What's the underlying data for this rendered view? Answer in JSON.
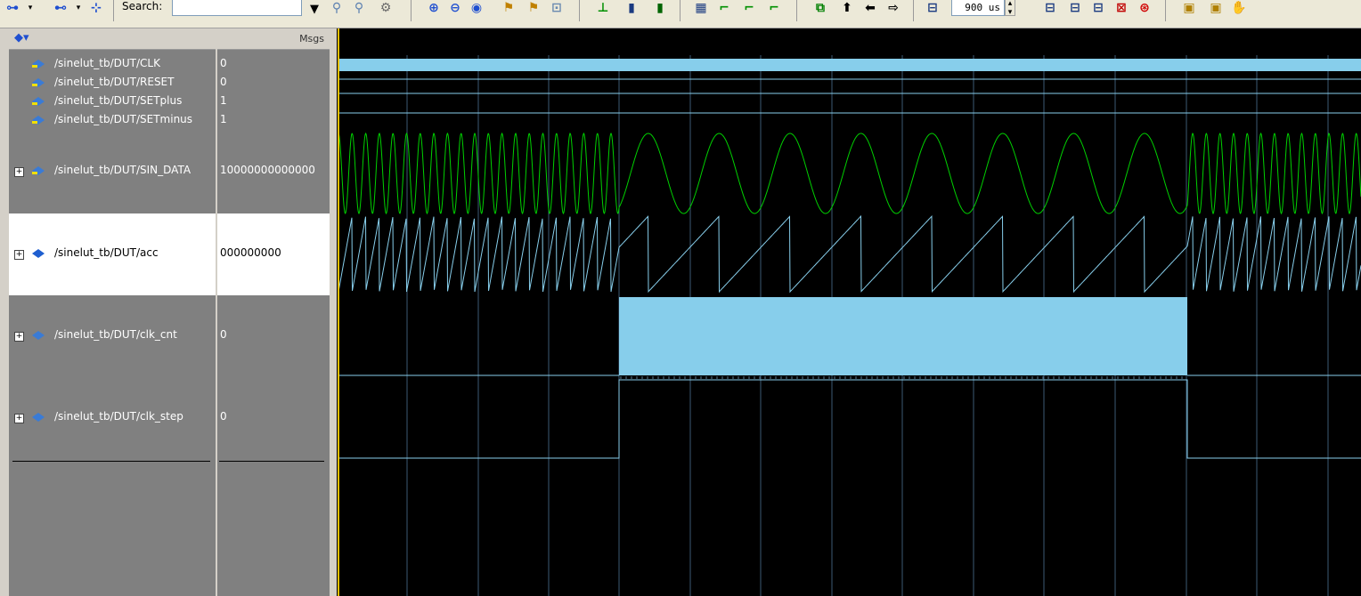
{
  "toolbar": {
    "search_label": "Search:",
    "search_value": "",
    "time_value": "900 us",
    "icons": [
      "wave-insert-icon",
      "wave-insert-divider-icon",
      "wave-group-icon",
      "find-icon",
      "find-next-icon",
      "find-prev-icon",
      "zoom-in-icon",
      "zoom-out-icon",
      "zoom-full-icon",
      "zoom-cursor-icon",
      "zoom-region-icon",
      "zoom-mode-icon",
      "cursor-add-icon",
      "cursor-delete-icon",
      "cursor-lock-icon",
      "format-literal-icon",
      "format-logic-icon",
      "format-event-icon",
      "format-analog-icon",
      "prev-edge-icon",
      "next-edge-icon",
      "prev-transition-icon",
      "restart-icon",
      "run-length-icon",
      "run-icon",
      "continue-icon",
      "run-all-icon",
      "break-icon",
      "stop-icon",
      "step-icon",
      "step-over-icon",
      "pan-icon"
    ]
  },
  "signals_header": {
    "msgs": "Msgs"
  },
  "signals": [
    {
      "name": "/sinelut_tb/DUT/CLK",
      "value": "0"
    },
    {
      "name": "/sinelut_tb/DUT/RESET",
      "value": "0"
    },
    {
      "name": "/sinelut_tb/DUT/SETplus",
      "value": "1"
    },
    {
      "name": "/sinelut_tb/DUT/SETminus",
      "value": "1"
    },
    {
      "name": "/sinelut_tb/DUT/SIN_DATA",
      "value": "10000000000000"
    },
    {
      "name": "/sinelut_tb/DUT/acc",
      "value": "000000000"
    },
    {
      "name": "/sinelut_tb/DUT/clk_cnt",
      "value": "0"
    },
    {
      "name": "/sinelut_tb/DUT/clk_step",
      "value": "0"
    }
  ],
  "colors": {
    "waveform_bg": "#000000",
    "grid": "#3c5a74",
    "logic": "#87ceeb",
    "analog_green": "#00d000",
    "cursor": "#e8c000",
    "pane_gray": "#808080",
    "selected_row": "#ffffff"
  }
}
